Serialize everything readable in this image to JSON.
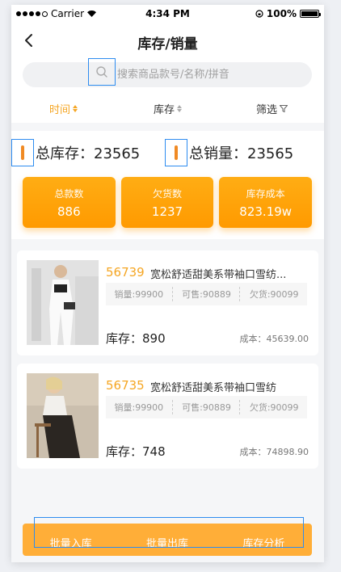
{
  "status_bar": {
    "carrier": "Carrier",
    "time": "4:34 PM",
    "battery": "100%",
    "battery_level": 1.0
  },
  "nav": {
    "title": "库存/销量",
    "back_icon": "chevron-left-icon"
  },
  "search": {
    "placeholder": "搜索商品款号/名称/拼音",
    "icon": "search-icon"
  },
  "filters": [
    {
      "label": "时间",
      "active": true,
      "icon": "sort-icon"
    },
    {
      "label": "库存",
      "active": false,
      "icon": "sort-icon"
    },
    {
      "label": "筛选",
      "active": false,
      "icon": "funnel-icon"
    }
  ],
  "summary": {
    "total_stock": "总库存：23565",
    "total_sales": "总销量：23565",
    "cards": [
      {
        "label": "总款数",
        "value": "886"
      },
      {
        "label": "欠货数",
        "value": "1237"
      },
      {
        "label": "库存成本",
        "value": "823.19w"
      }
    ]
  },
  "products": [
    {
      "code": "56739",
      "name": "宽松舒适甜美系带袖口雪纺...",
      "sales": "销量:99900",
      "available": "可售:90889",
      "owed": "欠货:90099",
      "stock": "库存：890",
      "cost": "成本：45639.00"
    },
    {
      "code": "56735",
      "name": "宽松舒适甜美系带袖口雪纺",
      "sales": "销量:99900",
      "available": "可售:90889",
      "owed": "欠货:90099",
      "stock": "库存：748",
      "cost": "成本：74898.90"
    }
  ],
  "actions": {
    "batch_in": "批量入库",
    "batch_out": "批量出库",
    "analysis": "库存分析"
  },
  "colors": {
    "accent": "#f5a623",
    "card": "#ff9a00",
    "highlight_frame": "#2d8cf0"
  }
}
